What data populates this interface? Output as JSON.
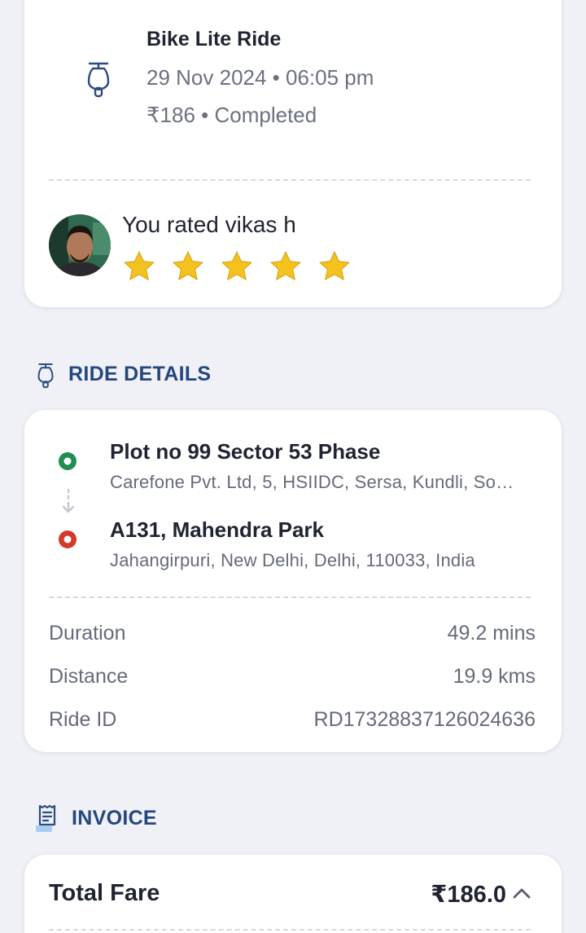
{
  "summary": {
    "title": "Bike Lite Ride",
    "datetime": "29 Nov 2024 • 06:05 pm",
    "fare_status": "₹186 • Completed",
    "rating_text": "You rated vikas h",
    "rating_stars": 5,
    "rating_max": 5
  },
  "ride_details": {
    "header": "RIDE DETAILS",
    "pickup": {
      "title": "Plot no 99 Sector 53 Phase",
      "address": "Carefone Pvt. Ltd, 5, HSIIDC, Sersa, Kundli, So…"
    },
    "drop": {
      "title": "A131, Mahendra Park",
      "address": "Jahangirpuri, New Delhi, Delhi, 110033, India"
    },
    "stats": {
      "duration_label": "Duration",
      "duration_value": "49.2 mins",
      "distance_label": "Distance",
      "distance_value": "19.9 kms",
      "ride_id_label": "Ride ID",
      "ride_id_value": "RD17328837126024636"
    }
  },
  "invoice": {
    "header": "INVOICE",
    "total_label": "Total Fare",
    "total_value": "₹186.0"
  },
  "colors": {
    "accent_navy": "#24477e",
    "star": "#f4c21f",
    "pickup": "#1f8f4f",
    "drop": "#d23a2a",
    "background": "#f0f0f7"
  }
}
